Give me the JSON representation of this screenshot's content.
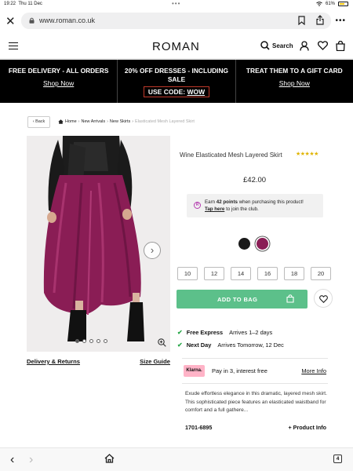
{
  "status_bar": {
    "time": "19:22",
    "date": "Thu 11 Dec",
    "battery": "61%"
  },
  "browser": {
    "url": "www.roman.co.uk"
  },
  "header": {
    "logo": "ROMAN",
    "search_label": "Search"
  },
  "promo": [
    {
      "title": "FREE DELIVERY - ALL ORDERS",
      "link": "Shop Now"
    },
    {
      "title": "20% OFF DRESSES - INCLUDING SALE",
      "code_prefix": "USE CODE: ",
      "code": "WOW"
    },
    {
      "title": "TREAT THEM TO A GIFT CARD",
      "link": "Shop Now"
    }
  ],
  "breadcrumb": {
    "back": "‹ Back",
    "items": [
      "Home",
      "New Arrivals",
      "New Skirts"
    ],
    "current": "Elasticated Mesh Layered Skirt"
  },
  "gallery": {
    "dot_count": 5,
    "active_dot": 0
  },
  "links": {
    "delivery": "Delivery & Returns",
    "size_guide": "Size Guide"
  },
  "product": {
    "name": "Wine Elasticated Mesh Layered Skirt",
    "rating": 5,
    "price": "£42.00"
  },
  "loyalty": {
    "pre": "Earn ",
    "points": "42 points",
    "post": " when purchasing this product!",
    "link": "Tap here",
    "link_post": " to join the club."
  },
  "swatches": [
    {
      "name": "Black",
      "color": "#1a1a1a",
      "selected": false
    },
    {
      "name": "Wine",
      "color": "#8a1d55",
      "selected": true
    }
  ],
  "sizes": [
    "10",
    "12",
    "14",
    "16",
    "18",
    "20"
  ],
  "cta": {
    "add_to_bag": "ADD TO BAG",
    "color": "#5cc08a"
  },
  "delivery": [
    {
      "label": "Free Express",
      "detail": "Arrives 1–2 days"
    },
    {
      "label": "Next Day",
      "detail": "Arrives Tomorrow, 12 Dec"
    }
  ],
  "klarna": {
    "badge": "Klarna.",
    "text": "Pay in 3, interest free",
    "more": "More Info"
  },
  "description": "Exude effortless elegance in this dramatic, layered mesh skirt. This sophisticated piece features an elasticated waistband for comfort and a full gathere...",
  "product_code": "1701-6895",
  "product_info_label": "+ Product Info",
  "tabs_count": "4",
  "colors": {
    "accent_green": "#5cc08a",
    "tick_green": "#2aa84a",
    "star_gold": "#e0b400",
    "klarna_pink": "#ffb3c7",
    "loyalty_purple": "#b53cb0"
  }
}
